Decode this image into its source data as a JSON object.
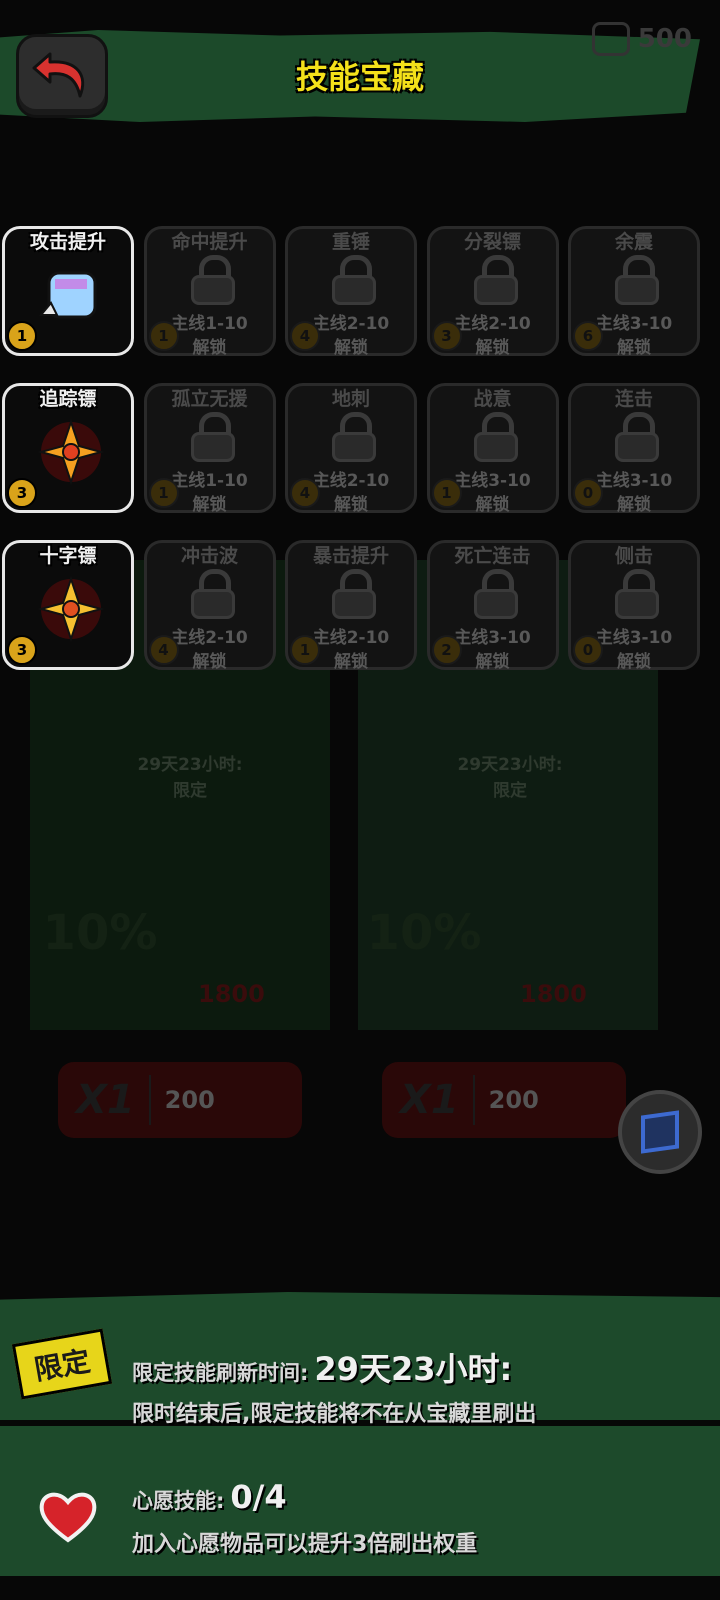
{
  "header": {
    "title": "技能宝藏",
    "currency_amount": "500"
  },
  "skills": [
    {
      "name": "攻击提升",
      "level": "1",
      "locked": false,
      "requirement": "",
      "unlock": ""
    },
    {
      "name": "命中提升",
      "level": "1",
      "locked": true,
      "requirement": "主线1-10",
      "unlock": "解锁"
    },
    {
      "name": "重锤",
      "level": "4",
      "locked": true,
      "requirement": "主线2-10",
      "unlock": "解锁"
    },
    {
      "name": "分裂镖",
      "level": "3",
      "locked": true,
      "requirement": "主线2-10",
      "unlock": "解锁"
    },
    {
      "name": "余震",
      "level": "6",
      "locked": true,
      "requirement": "主线3-10",
      "unlock": "解锁"
    },
    {
      "name": "追踪镖",
      "level": "3",
      "locked": false,
      "requirement": "",
      "unlock": ""
    },
    {
      "name": "孤立无援",
      "level": "1",
      "locked": true,
      "requirement": "主线1-10",
      "unlock": "解锁"
    },
    {
      "name": "地刺",
      "level": "4",
      "locked": true,
      "requirement": "主线2-10",
      "unlock": "解锁"
    },
    {
      "name": "战意",
      "level": "1",
      "locked": true,
      "requirement": "主线3-10",
      "unlock": "解锁"
    },
    {
      "name": "连击",
      "level": "0",
      "locked": true,
      "requirement": "主线3-10",
      "unlock": "解锁"
    },
    {
      "name": "十字镖",
      "level": "3",
      "locked": false,
      "requirement": "",
      "unlock": ""
    },
    {
      "name": "冲击波",
      "level": "4",
      "locked": true,
      "requirement": "主线2-10",
      "unlock": "解锁"
    },
    {
      "name": "暴击提升",
      "level": "1",
      "locked": true,
      "requirement": "主线2-10",
      "unlock": "解锁"
    },
    {
      "name": "死亡连击",
      "level": "2",
      "locked": true,
      "requirement": "主线3-10",
      "unlock": "解锁"
    },
    {
      "name": "侧击",
      "level": "0",
      "locked": true,
      "requirement": "主线3-10",
      "unlock": "解锁"
    }
  ],
  "background_shop": [
    {
      "timer": "29天23小时:",
      "tag": "限定",
      "discount": "10%",
      "price": "1800",
      "count": "X1",
      "cost": "200"
    },
    {
      "timer": "29天23小时:",
      "tag": "限定",
      "discount": "10%",
      "price": "1800",
      "count": "X1",
      "cost": "200"
    }
  ],
  "limited_info": {
    "badge": "限定",
    "refresh_label": "限定技能刷新时间:",
    "refresh_time": "29天23小时:",
    "note": "限时结束后,限定技能将不在从宝藏里刷出"
  },
  "wish_info": {
    "label": "心愿技能:",
    "count": "0/4",
    "note": "加入心愿物品可以提升3倍刷出权重"
  },
  "colors": {
    "title_yellow": "#f4e11a",
    "panel_green": "#1d4a2b",
    "level_badge": "#d9a31a"
  }
}
